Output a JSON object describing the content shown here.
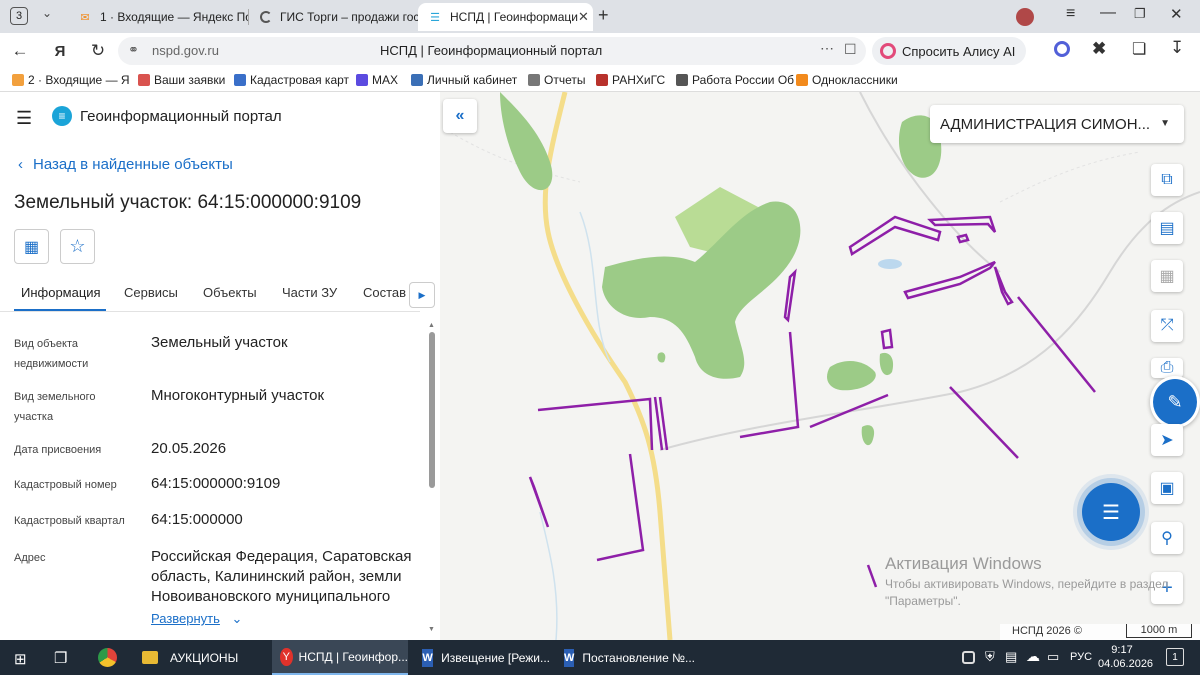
{
  "browser": {
    "tab_counter": "3",
    "tabs": [
      {
        "title": "1 · Входящие — Яндекс По"
      },
      {
        "title": "ГИС Торги – продажи гос"
      },
      {
        "title": "НСПД | Геоинформаци"
      }
    ],
    "url": "nspd.gov.ru",
    "page_title": "НСПД | Геоинформационный портал",
    "alice_label": "Спросить Алису AI",
    "bookmarks": [
      {
        "label": "2 · Входящие — Я",
        "color": "#f2a03d"
      },
      {
        "label": "Ваши заявки",
        "color": "#d9534f"
      },
      {
        "label": "Кадастровая карт",
        "color": "#3a6fc9"
      },
      {
        "label": "MAX",
        "color": "#5b4be0"
      },
      {
        "label": "Личный кабинет",
        "color": "#3b6fb6"
      },
      {
        "label": "Отчеты",
        "color": "#777777"
      },
      {
        "label": "РАНХиГС",
        "color": "#b8322c"
      },
      {
        "label": "Работа России Об",
        "color": "#555555"
      },
      {
        "label": "Одноклассники",
        "color": "#f28a1c"
      }
    ]
  },
  "portal": {
    "title": "Геоинформационный портал",
    "back_link": "Назад в найденные объекты",
    "object_heading": "Земельный участок: 64:15:000000:9109",
    "tabs": [
      "Информация",
      "Сервисы",
      "Объекты",
      "Части ЗУ",
      "Состав"
    ],
    "fields": [
      {
        "label": "Вид объекта недвижимости",
        "value": "Земельный участок"
      },
      {
        "label": "Вид земельного участка",
        "value": "Многоконтурный участок"
      },
      {
        "label": "Дата присвоения",
        "value": "20.05.2026"
      },
      {
        "label": "Кадастровый номер",
        "value": "64:15:000000:9109"
      },
      {
        "label": "Кадастровый квартал",
        "value": "64:15:000000"
      },
      {
        "label": "Адрес",
        "value": "Российская Федерация, Саратовская область, Калининский район, земли Новоивановского муниципального"
      }
    ],
    "expand_link": "Развернуть"
  },
  "map": {
    "layer_select": "АДМИНИСТРАЦИЯ СИМОН...",
    "watermark_title": "Активация Windows",
    "watermark_text": "Чтобы активировать Windows, перейдите в раздел \"Параметры\".",
    "copyright": "НСПД 2026 ©",
    "scale": "1000 m",
    "parcel_color": "#8e1fa8",
    "forest_color": "#9ccb87"
  },
  "taskbar": {
    "items": [
      {
        "label": "АУКЦИОНЫ"
      },
      {
        "label": "НСПД | Геоинфор..."
      },
      {
        "label": "Извещение [Режи..."
      },
      {
        "label": "Постановление №..."
      }
    ],
    "lang": "РУС",
    "time": "9:17",
    "date": "04.06.2026",
    "notif_count": "1"
  }
}
